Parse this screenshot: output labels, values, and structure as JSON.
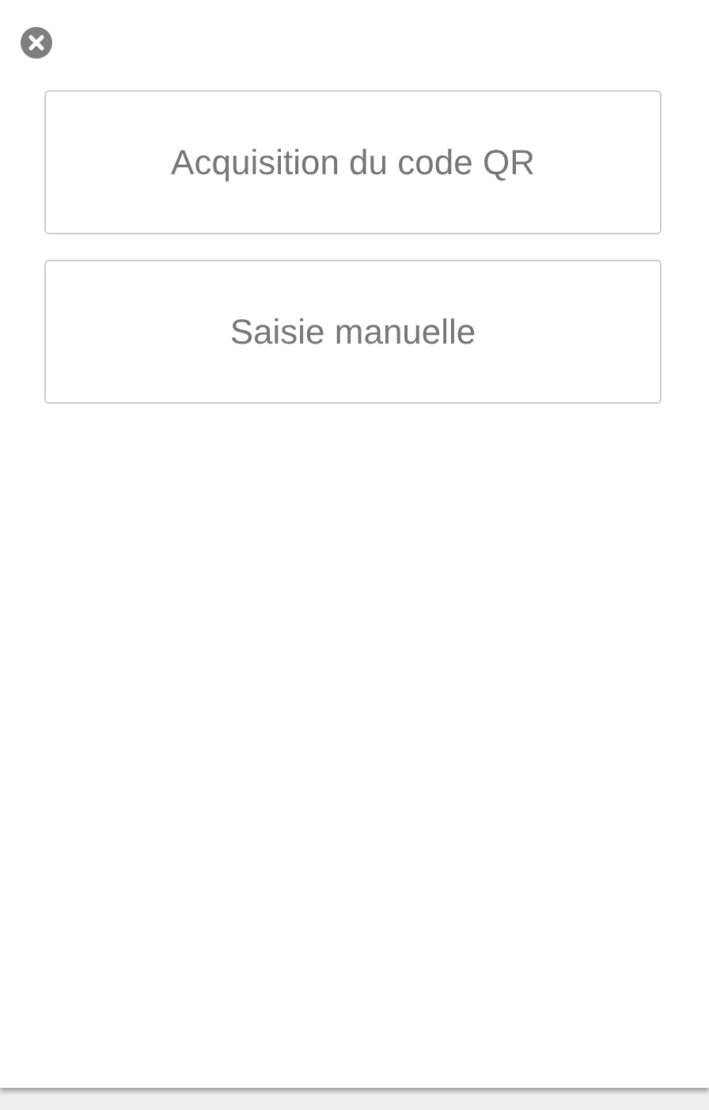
{
  "options": [
    {
      "label": "Acquisition du code QR"
    },
    {
      "label": "Saisie manuelle"
    }
  ]
}
